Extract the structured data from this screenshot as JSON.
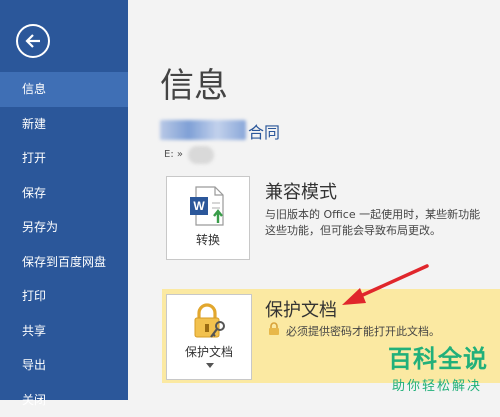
{
  "sidebar": {
    "back_icon": "back-arrow-icon",
    "items": [
      {
        "label": "信息",
        "active": true
      },
      {
        "label": "新建"
      },
      {
        "label": "打开"
      },
      {
        "label": "保存"
      },
      {
        "label": "另存为"
      },
      {
        "label": "保存到百度网盘"
      },
      {
        "label": "打印"
      },
      {
        "label": "共享"
      },
      {
        "label": "导出"
      },
      {
        "label": "关闭"
      }
    ],
    "color": "#2b579a"
  },
  "main": {
    "title": "信息",
    "doc_name": "合同",
    "doc_path": "E: »",
    "compat": {
      "button_label": "转换",
      "title": "兼容模式",
      "description_line1": "与旧版本的 Office 一起使用时，某些新功能",
      "description_line2": "这些功能，但可能会导致布局更改。"
    },
    "protect": {
      "button_label": "保护文档",
      "title": "保护文档",
      "description": "必须提供密码才能打开此文档。",
      "highlight_color": "#fbe9a2"
    }
  },
  "watermark": {
    "title": "百科全说",
    "subtitle": "助你轻松解决",
    "color": "#21b07a"
  }
}
